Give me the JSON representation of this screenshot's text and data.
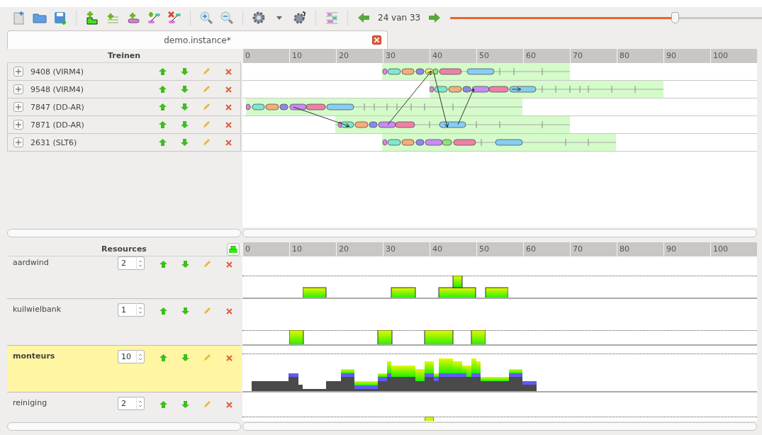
{
  "toolbar": {
    "page_indicator": "24 van 33",
    "slider": {
      "level": 0.72
    }
  },
  "tabs": [
    {
      "label": "demo.instance*",
      "selected": true
    }
  ],
  "trains_panel": {
    "header": "Treinen",
    "ruler": [
      "0",
      "10",
      "20",
      "30",
      "40",
      "50",
      "60",
      "70",
      "80",
      "90",
      "100"
    ],
    "rows": [
      {
        "name": "9408 (VIRM4)"
      },
      {
        "name": "9548 (VIRM4)"
      },
      {
        "name": "7847 (DD-AR)"
      },
      {
        "name": "7871 (DD-AR)"
      },
      {
        "name": "2631 (SLT6)"
      }
    ]
  },
  "resources_panel": {
    "header": "Resources",
    "ruler": [
      "0",
      "10",
      "20",
      "30",
      "40",
      "50",
      "60",
      "70",
      "80",
      "90",
      "100"
    ],
    "rows": [
      {
        "name": "aardwind",
        "count": "2",
        "selected": false
      },
      {
        "name": "kuilwielbank",
        "count": "1",
        "selected": false
      },
      {
        "name": "monteurs",
        "count": "10",
        "selected": true
      },
      {
        "name": "reiniging",
        "count": "2",
        "selected": false
      }
    ]
  }
}
